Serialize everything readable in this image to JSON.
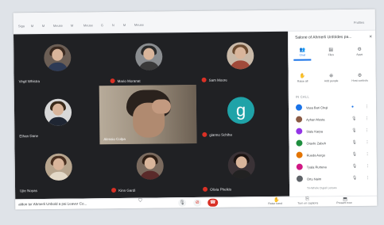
{
  "bookmarks": [
    "Siga",
    "M",
    "M",
    "Meuse",
    "M",
    "Meuse",
    "G",
    "N",
    "M",
    "Meuse"
  ],
  "toolbar_right": "Profiles",
  "participants_grid": [
    {
      "name": "Virgil Whistra"
    },
    {
      "name": "Mario Moranat"
    },
    {
      "name": "Sam Moore"
    },
    {
      "name": "Ethan Dane"
    },
    {
      "name": "gianno Schiha",
      "initial": "g"
    },
    {
      "name": "Ujie Noyas"
    },
    {
      "name": "Kinn Gardi"
    },
    {
      "name": "Olivia Phelkis"
    }
  ],
  "center_video": {
    "name": "Alessio Colpa"
  },
  "bottom": {
    "meeting_title": "aldon ter Ahmerli Unbold a pai Leaver Co...",
    "raise_hand": "Raise hand",
    "captions": "Turn on captions",
    "present": "Present now"
  },
  "panel": {
    "title": "Salone of Ahmerli Unfoldes pa...",
    "tabs": [
      "Chat",
      "Files",
      "Apps"
    ],
    "actions": [
      "Raise all",
      "Add people",
      "Host controls"
    ],
    "section_label": "IN CALL",
    "people": [
      {
        "name": "Vasa Bari Chuji",
        "color": "#1a73e8"
      },
      {
        "name": "Ayhan Musta",
        "color": "#8a5a44"
      },
      {
        "name": "Slalu Karpa",
        "color": "#9334e6"
      },
      {
        "name": "Oravfe Zabeh",
        "color": "#1e8e3e"
      },
      {
        "name": "Rueda Aurgo",
        "color": "#e37400"
      },
      {
        "name": "Tyala Rurtena",
        "color": "#d01884"
      },
      {
        "name": "Ortu Naim",
        "color": "#5f6368"
      }
    ],
    "footer": "Tri-Whole Dupel Lenses"
  },
  "accent_color": "#1a73e8",
  "end_call_color": "#d93025"
}
